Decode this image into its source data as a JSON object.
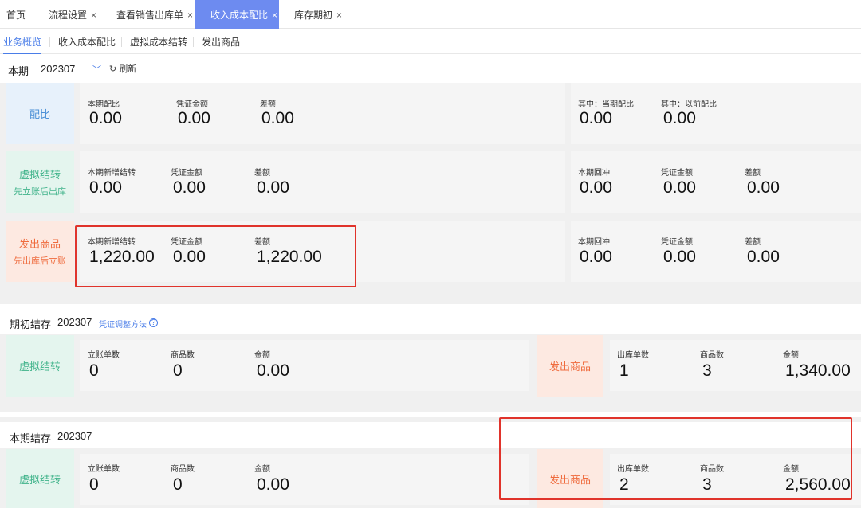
{
  "tabs": [
    {
      "label": "首页",
      "closable": false
    },
    {
      "label": "流程设置",
      "closable": true
    },
    {
      "label": "查看销售出库单",
      "closable": true
    },
    {
      "label": "收入成本配比",
      "closable": true,
      "active": true
    },
    {
      "label": "库存期初",
      "closable": true
    }
  ],
  "close_glyph": "×",
  "subnav": [
    "业务概览",
    "收入成本配比",
    "虚拟成本结转",
    "发出商品"
  ],
  "period": {
    "label": "本期",
    "value": "202307",
    "refresh": "刷新"
  },
  "match": {
    "tag": "配比",
    "left": [
      {
        "label": "本期配比",
        "value": "0.00"
      },
      {
        "label": "凭证金额",
        "value": "0.00"
      },
      {
        "label": "差额",
        "value": "0.00"
      }
    ],
    "right": [
      {
        "label": "其中：当期配比",
        "value": "0.00"
      },
      {
        "label": "其中：以前配比",
        "value": "0.00"
      }
    ]
  },
  "virtual": {
    "tag": "虚拟结转",
    "tag_sub": "先立账后出库",
    "left": [
      {
        "label": "本期新增结转",
        "value": "0.00"
      },
      {
        "label": "凭证金额",
        "value": "0.00"
      },
      {
        "label": "差额",
        "value": "0.00"
      }
    ],
    "right": [
      {
        "label": "本期回冲",
        "value": "0.00"
      },
      {
        "label": "凭证金额",
        "value": "0.00"
      },
      {
        "label": "差额",
        "value": "0.00"
      }
    ]
  },
  "shipped": {
    "tag": "发出商品",
    "tag_sub": "先出库后立账",
    "left": [
      {
        "label": "本期新增结转",
        "value": "1,220.00"
      },
      {
        "label": "凭证金额",
        "value": "0.00"
      },
      {
        "label": "差额",
        "value": "1,220.00"
      }
    ],
    "right": [
      {
        "label": "本期回冲",
        "value": "0.00"
      },
      {
        "label": "凭证金额",
        "value": "0.00"
      },
      {
        "label": "差额",
        "value": "0.00"
      }
    ]
  },
  "opening": {
    "title": "期初结存",
    "period": "202307",
    "link": "凭证调整方法",
    "help": "?",
    "left_tag": "虚拟结转",
    "left": [
      {
        "label": "立账单数",
        "value": "0"
      },
      {
        "label": "商品数",
        "value": "0"
      },
      {
        "label": "金额",
        "value": "0.00"
      }
    ],
    "right_tag": "发出商品",
    "right": [
      {
        "label": "出库单数",
        "value": "1"
      },
      {
        "label": "商品数",
        "value": "3"
      },
      {
        "label": "金额",
        "value": "1,340.00"
      }
    ]
  },
  "closing": {
    "title": "本期结存",
    "period": "202307",
    "left_tag": "虚拟结转",
    "left": [
      {
        "label": "立账单数",
        "value": "0"
      },
      {
        "label": "商品数",
        "value": "0"
      },
      {
        "label": "金额",
        "value": "0.00"
      }
    ],
    "right_tag": "发出商品",
    "right": [
      {
        "label": "出库单数",
        "value": "2"
      },
      {
        "label": "商品数",
        "value": "3"
      },
      {
        "label": "金额",
        "value": "2,560.00"
      }
    ]
  },
  "colors": {
    "accent": "#4a7de8",
    "active_tab": "#6d8bf0",
    "highlight": "#e0332b",
    "orange": "#ef6b3d",
    "green": "#3fb38a",
    "blue": "#4a8fd6"
  }
}
